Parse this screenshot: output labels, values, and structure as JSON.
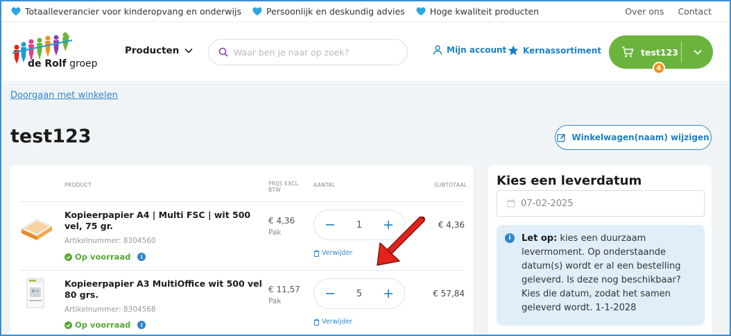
{
  "topbar": {
    "usps": [
      "Totaalleverancier voor kinderopvang en onderwijs",
      "Persoonlijk en deskundig advies",
      "Hoge kwaliteit producten"
    ],
    "links": [
      "Over ons",
      "Contact"
    ]
  },
  "header": {
    "logo_text_bold": "de Rolf",
    "logo_text": " groep",
    "products_label": "Producten",
    "search_placeholder": "Waar ben je naar op zoek?",
    "account_label": "Mijn account",
    "favorites_label": "Kernassortiment",
    "cart_name": "test123",
    "cart_count": "4"
  },
  "page": {
    "continue_label": "Doorgaan met winkelen",
    "title": "test123",
    "edit_label": "Winkelwagen(naam) wijzigen"
  },
  "table": {
    "col_product": "PRODUCT",
    "col_price_line1": "PRIJS EXCL.",
    "col_price_line2": "BTW",
    "col_qty": "AANTAL",
    "col_subtotal": "SUBTOTAAL",
    "remove_label": "Verwijder",
    "stock_label": "Op voorraad",
    "rows": [
      {
        "name": "Kopieerpapier A4 | Multi FSC | wit 500 vel, 75 gr.",
        "article": "Artikelnummer: 8304560",
        "price": "€ 4,36",
        "unit": "Pak",
        "qty": "1",
        "subtotal": "€ 4,36"
      },
      {
        "name": "Kopieerpapier A3 MultiOffice wit 500 vel 80 grs.",
        "article": "Artikelnummer: 8304568",
        "price": "€ 11,57",
        "unit": "Pak",
        "qty": "5",
        "subtotal": "€ 57,84"
      }
    ]
  },
  "delivery": {
    "title": "Kies een leverdatum",
    "date": "07-02-2025",
    "note_bold": "Let op:",
    "note_text": " kies een duurzaam levermoment. Op onderstaande datum(s) wordt er al een bestelling geleverd. Is deze nog beschikbaar? Kies die datum, zodat het samen geleverd wordt. 1-1-2028"
  },
  "colors": {
    "brand_green": "#6ab43e",
    "link_blue": "#2f86c9",
    "badge_orange": "#f29115",
    "annotation_red": "#e3231b"
  }
}
